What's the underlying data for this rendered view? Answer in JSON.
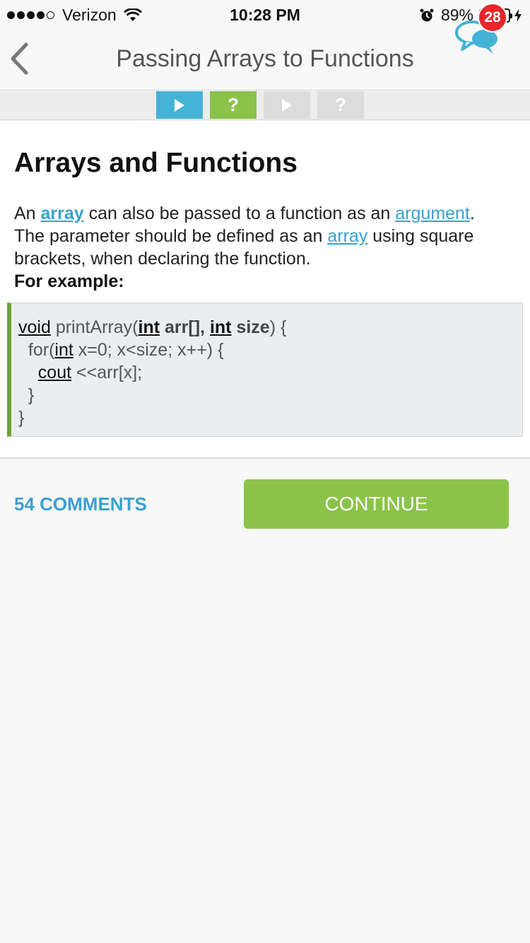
{
  "status_bar": {
    "carrier": "Verizon",
    "time": "10:28 PM",
    "battery_percent": "89%",
    "battery_level": 0.89,
    "signal_bars_filled": 4,
    "signal_bars_total": 5
  },
  "nav": {
    "title": "Passing Arrays to Functions",
    "back_icon": "chevron-left-icon",
    "chat_icon": "chat-bubbles-icon",
    "chat_badge_count": "28"
  },
  "progress": {
    "steps": [
      {
        "type": "play",
        "state": "current",
        "glyph": "▶"
      },
      {
        "type": "quiz",
        "state": "done",
        "glyph": "?"
      },
      {
        "type": "play",
        "state": "locked",
        "glyph": "▶"
      },
      {
        "type": "quiz",
        "state": "locked",
        "glyph": "?"
      }
    ]
  },
  "lesson": {
    "heading": "Arrays and Functions",
    "para": {
      "t1": "An ",
      "link1": "array",
      "t2": " can also be passed to a function as an ",
      "link2": "argument",
      "t3": ".",
      "t4": "The parameter should be defined as an ",
      "link3": "array",
      "t5": " using square brackets, when declaring the function."
    },
    "example_label": "For example:",
    "code": {
      "l1": {
        "kw": "void",
        "a": " printArray(",
        "kw2": "int",
        "b1": " arr[]",
        "c": ", ",
        "kw3": "int",
        "b2": " size",
        "d": ") {"
      },
      "l2": {
        "indent": "  for(",
        "kw": "int",
        "rest": " x=0; x<size; x++) {"
      },
      "l3": {
        "indent": "    ",
        "kw": "cout",
        "rest": " <<arr[x];"
      },
      "l4": "  }",
      "l5": "}"
    }
  },
  "actions": {
    "comments": "54 COMMENTS",
    "continue": "CONTINUE"
  },
  "colors": {
    "accent_blue": "#45b3d6",
    "accent_green": "#8bc34a",
    "badge_red": "#e8262a",
    "code_border": "#6aa532"
  }
}
